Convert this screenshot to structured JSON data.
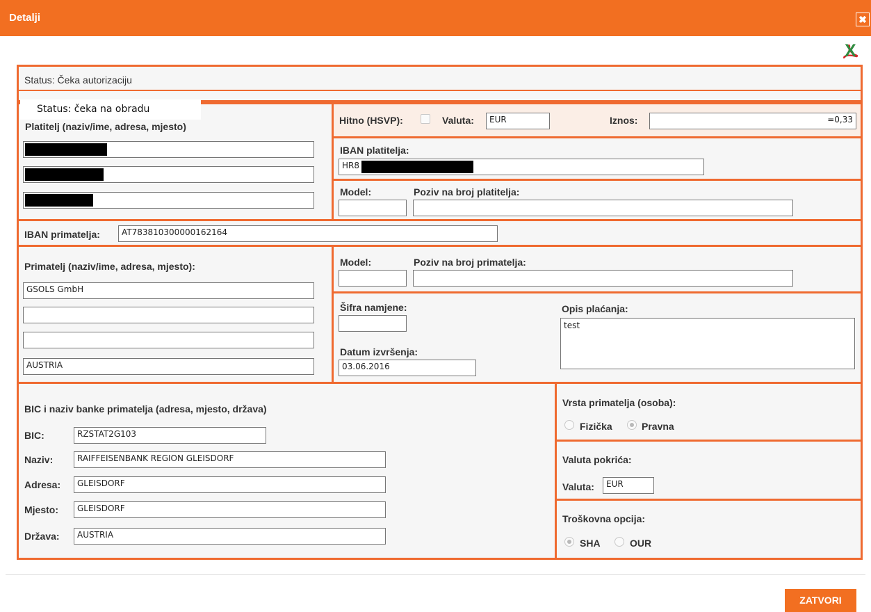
{
  "dialog": {
    "title": "Detalji",
    "close_symbol": "✖",
    "excel_symbol": "X",
    "status_label": "Status: Čeka autorizaciju",
    "overlay_status": "Status: čeka na obradu"
  },
  "payer": {
    "label": "Platitelj (naziv/ime, adresa, mjesto)",
    "line1": "",
    "line2": "",
    "line3": ""
  },
  "top": {
    "urgent_label": "Hitno (HSVP):",
    "currency_label": "Valuta:",
    "currency_value": "EUR",
    "amount_label": "Iznos:",
    "amount_value": "=0,33"
  },
  "payer_iban": {
    "label": "IBAN platitelja:",
    "value": "HR8"
  },
  "payer_ref": {
    "model_label": "Model:",
    "model_value": "",
    "ref_label": "Poziv na broj platitelja:",
    "ref_value": ""
  },
  "recipient_iban": {
    "label": "IBAN primatelja:",
    "value": "AT783810300000162164"
  },
  "recipient": {
    "label": "Primatelj (naziv/ime, adresa, mjesto):",
    "line1": "GSOLS GmbH",
    "line2": "",
    "line3": "",
    "line4": "AUSTRIA"
  },
  "recipient_ref": {
    "model_label": "Model:",
    "model_value": "",
    "ref_label": "Poziv na broj primatelja:",
    "ref_value": ""
  },
  "purpose": {
    "code_label": "Šifra namjene:",
    "code_value": "",
    "date_label": "Datum izvršenja:",
    "date_value": "03.06.2016",
    "desc_label": "Opis plaćanja:",
    "desc_value": "test"
  },
  "bank": {
    "section_label": "BIC i naziv banke primatelja (adresa, mjesto, država)",
    "bic_label": "BIC:",
    "bic_value": "RZSTAT2G103",
    "name_label": "Naziv:",
    "name_value": "RAIFFEISENBANK REGION GLEISDORF",
    "address_label": "Adresa:",
    "address_value": "GLEISDORF",
    "city_label": "Mjesto:",
    "city_value": "GLEISDORF",
    "country_label": "Država:",
    "country_value": "AUSTRIA"
  },
  "recipient_type": {
    "label": "Vrsta primatelja (osoba):",
    "opt1": "Fizička",
    "opt2": "Pravna",
    "selected": "Pravna"
  },
  "cover_currency": {
    "label": "Valuta pokrića:",
    "currency_label": "Valuta:",
    "currency_value": "EUR"
  },
  "cost_option": {
    "label": "Troškovna opcija:",
    "opt1": "SHA",
    "opt2": "OUR",
    "selected": "SHA"
  },
  "footer": {
    "close_label": "ZATVORI"
  },
  "colors": {
    "accent": "#f26f21",
    "border": "#ef6a30",
    "panel": "#f6f6f6",
    "highlight": "#fbeee6",
    "excel": "#2e8b3f",
    "pdf": "#d9262c"
  }
}
